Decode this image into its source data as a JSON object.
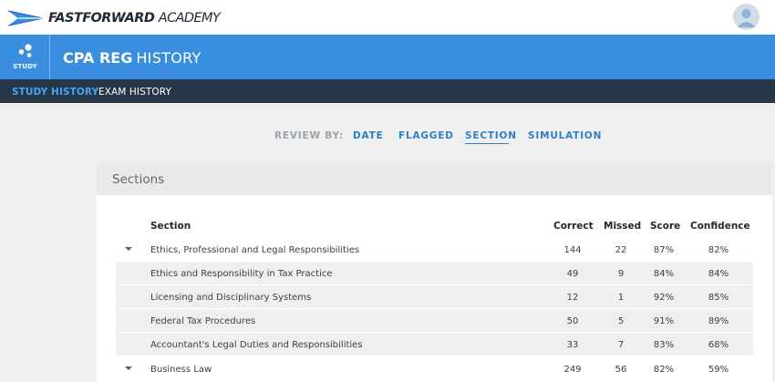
{
  "brand": {
    "name_bold": "FASTFORWARD",
    "name_light": "ACADEMY"
  },
  "header": {
    "study_label": "STUDY",
    "title_bold": "CPA REG",
    "title_light": "HISTORY"
  },
  "nav": {
    "tabs": [
      {
        "label": "STUDY HISTORY",
        "active": true
      },
      {
        "label": "EXAM HISTORY",
        "active": false
      }
    ]
  },
  "review": {
    "label": "REVIEW BY:",
    "options": [
      "DATE",
      "FLAGGED",
      "SECTION",
      "SIMULATION"
    ],
    "selected": "SECTION"
  },
  "panel": {
    "title": "Sections"
  },
  "table": {
    "columns": [
      "Section",
      "Correct",
      "Missed",
      "Score",
      "Confidence"
    ],
    "rows": [
      {
        "type": "group",
        "name": "Ethics, Professional and Legal Responsibilities",
        "correct": "144",
        "missed": "22",
        "score": "87%",
        "confidence": "82%"
      },
      {
        "type": "sub",
        "name": "Ethics and Responsibility in Tax Practice",
        "correct": "49",
        "missed": "9",
        "score": "84%",
        "confidence": "84%"
      },
      {
        "type": "sub",
        "name": "Licensing and Disciplinary Systems",
        "correct": "12",
        "missed": "1",
        "score": "92%",
        "confidence": "85%"
      },
      {
        "type": "sub",
        "name": "Federal Tax Procedures",
        "correct": "50",
        "missed": "5",
        "score": "91%",
        "confidence": "89%"
      },
      {
        "type": "sub",
        "name": "Accountant's Legal Duties and Responsibilities",
        "correct": "33",
        "missed": "7",
        "score": "83%",
        "confidence": "68%"
      },
      {
        "type": "group",
        "name": "Business Law",
        "correct": "249",
        "missed": "56",
        "score": "82%",
        "confidence": "59%"
      }
    ]
  },
  "colors": {
    "primary_blue": "#3a8ee0",
    "nav_dark": "#253646",
    "accent_link": "#2f7fc6"
  },
  "icons": {
    "logo": "paper-plane-icon",
    "study": "dots-icon",
    "avatar": "user-avatar-icon",
    "caret": "caret-down-icon"
  }
}
